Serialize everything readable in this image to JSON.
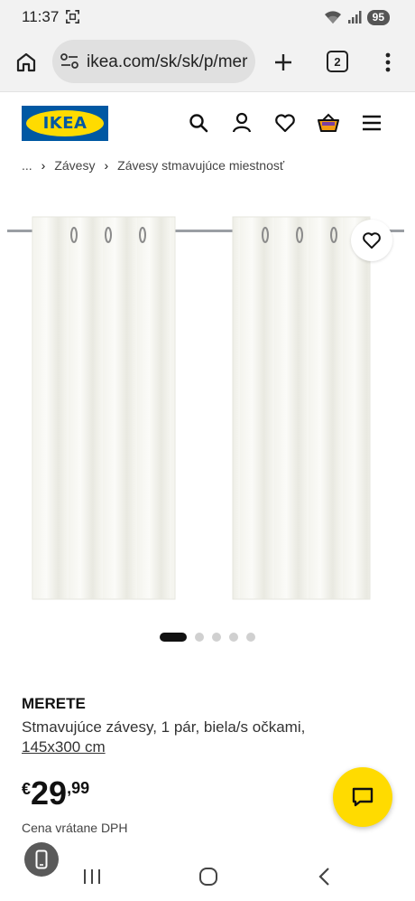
{
  "status_bar": {
    "time": "11:37",
    "battery": "95"
  },
  "browser": {
    "url": "ikea.com/sk/sk/p/mer",
    "tab_count": "2"
  },
  "header": {
    "logo_text": "IKEA",
    "icons": [
      "search-icon",
      "account-icon",
      "heart-icon",
      "basket-icon",
      "hamburger-menu-icon"
    ]
  },
  "breadcrumb": {
    "ellipsis": "...",
    "items": [
      "Závesy",
      "Závesy stmavujúce miestnosť"
    ]
  },
  "carousel": {
    "total": 5,
    "active_index": 0
  },
  "product": {
    "name": "MERETE",
    "description": "Stmavujúce závesy, 1 pár, biela/s očkami,",
    "size": "145x300 cm",
    "price_currency": "€",
    "price_integer": "29",
    "price_separator": ",",
    "price_decimal": "99",
    "price_note": "Cena vrátane DPH"
  },
  "colors": {
    "ikea_blue": "#0058a3",
    "ikea_yellow": "#ffdb00"
  }
}
